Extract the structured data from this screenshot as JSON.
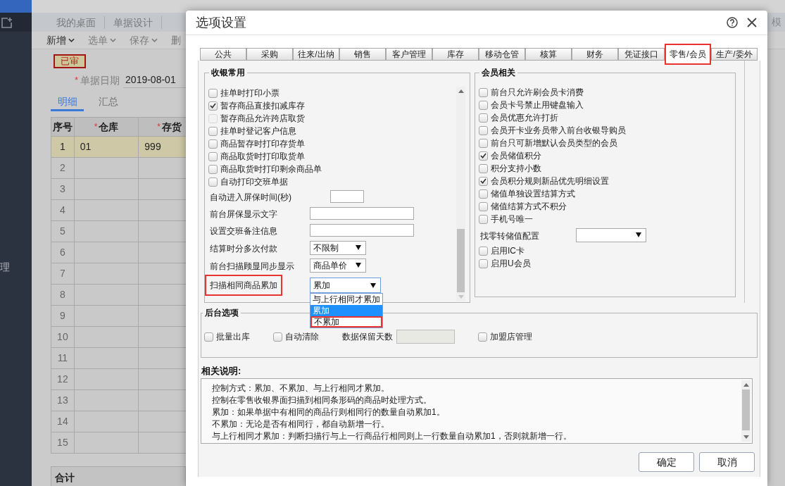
{
  "sidebar": {
    "menu_items": [
      {
        "label": "理"
      }
    ]
  },
  "nav_tabs": [
    {
      "label": "我的桌面"
    },
    {
      "label": "单据设计"
    }
  ],
  "nav_right": "模",
  "toolbar": [
    {
      "label": "新增",
      "caret": true,
      "disabled": false
    },
    {
      "label": "选单",
      "caret": true,
      "disabled": true
    },
    {
      "label": "保存",
      "caret": true,
      "disabled": true
    },
    {
      "label": "删",
      "caret": false,
      "disabled": true
    }
  ],
  "document": {
    "status_badge": "已审",
    "date_field": {
      "required_mark": "*",
      "label": "单据日期",
      "value": "2019-08-01"
    },
    "tabs": [
      {
        "label": "明细",
        "selected": true
      },
      {
        "label": "汇总",
        "selected": false
      }
    ],
    "table": {
      "columns": [
        {
          "label": "序号"
        },
        {
          "required_mark": "*",
          "label": "仓库"
        },
        {
          "required_mark": "*",
          "label": "存货"
        }
      ],
      "rows": [
        {
          "number": "1",
          "cells": [
            "01",
            "999"
          ],
          "selected": true
        },
        {
          "number": "2",
          "selected": false
        },
        {
          "number": "3",
          "selected": false
        },
        {
          "number": "4",
          "selected": false
        },
        {
          "number": "5",
          "selected": false
        },
        {
          "number": "6",
          "selected": false
        },
        {
          "number": "7",
          "selected": false
        },
        {
          "number": "8",
          "selected": false
        },
        {
          "number": "9",
          "selected": false
        },
        {
          "number": "10",
          "selected": false
        },
        {
          "number": "11",
          "selected": false
        },
        {
          "number": "12",
          "selected": false
        },
        {
          "number": "13",
          "selected": false
        },
        {
          "number": "14",
          "selected": false
        },
        {
          "number": "15",
          "selected": false
        }
      ],
      "footer_label": "合计"
    }
  },
  "dialog": {
    "title": "选项设置",
    "tabs": [
      {
        "label": "公共",
        "selected": false,
        "highlighted": false
      },
      {
        "label": "采购",
        "selected": false,
        "highlighted": false
      },
      {
        "label": "往来/出纳",
        "selected": false,
        "highlighted": false
      },
      {
        "label": "销售",
        "selected": false,
        "highlighted": false
      },
      {
        "label": "客户管理",
        "selected": false,
        "highlighted": false
      },
      {
        "label": "库存",
        "selected": false,
        "highlighted": false
      },
      {
        "label": "移动仓管",
        "selected": false,
        "highlighted": false
      },
      {
        "label": "核算",
        "selected": false,
        "highlighted": false
      },
      {
        "label": "财务",
        "selected": false,
        "highlighted": false
      },
      {
        "label": "凭证接口",
        "selected": false,
        "highlighted": false
      },
      {
        "label": "零售/会员",
        "selected": true,
        "highlighted": true
      },
      {
        "label": "生产/委外",
        "selected": false,
        "highlighted": false
      }
    ],
    "cashier_group": {
      "title": "收银常用",
      "options": [
        {
          "kind": "checkbox",
          "label": "挂单时打印小票",
          "checked": false,
          "disabled": false
        },
        {
          "kind": "checkbox",
          "label": "暂存商品直接扣减库存",
          "checked": true,
          "disabled": false
        },
        {
          "kind": "checkbox",
          "label": "暂存商品允许跨店取货",
          "checked": false,
          "disabled": true
        },
        {
          "kind": "checkbox",
          "label": "挂单时登记客户信息",
          "checked": false,
          "disabled": false
        },
        {
          "kind": "checkbox",
          "label": "商品暂存时打印存货单",
          "checked": false,
          "disabled": false
        },
        {
          "kind": "checkbox",
          "label": "商品取货时打印取货单",
          "checked": false,
          "disabled": false
        },
        {
          "kind": "checkbox",
          "label": "商品取货时打印剩余商品单",
          "checked": false,
          "disabled": false
        },
        {
          "kind": "checkbox",
          "label": "自动打印交班单据",
          "checked": false,
          "disabled": false
        },
        {
          "kind": "number",
          "label": "自动进入屏保时间(秒)",
          "disabled": false
        },
        {
          "kind": "text",
          "label": "前台屏保显示文字",
          "disabled": false
        },
        {
          "kind": "text",
          "label": "设置交班备注信息",
          "disabled": false
        },
        {
          "kind": "select",
          "label": "结算时分多次付款",
          "value": "不限制",
          "expanded": false,
          "highlighted": false
        },
        {
          "kind": "select",
          "label": "前台扫描顾显同步显示",
          "value": "商品单价",
          "expanded": false,
          "highlighted": false
        },
        {
          "kind": "select",
          "label": "扫描相同商品累加",
          "value": "累加",
          "expanded": true,
          "highlighted": true,
          "options": [
            {
              "label": "与上行相同才累加",
              "selected": false,
              "highlighted": false
            },
            {
              "label": "累加",
              "selected": true,
              "highlighted": false
            },
            {
              "label": "不累加",
              "selected": false,
              "highlighted": true
            }
          ]
        }
      ]
    },
    "member_group": {
      "title": "会员相关",
      "options": [
        {
          "kind": "checkbox",
          "label": "前台只允许刷会员卡消费",
          "checked": false,
          "disabled": false
        },
        {
          "kind": "checkbox",
          "label": "会员卡号禁止用键盘输入",
          "checked": false,
          "disabled": false
        },
        {
          "kind": "checkbox",
          "label": "会员优惠允许打折",
          "checked": false,
          "disabled": false
        },
        {
          "kind": "checkbox",
          "label": "会员开卡业务员带入前台收银导购员",
          "checked": false,
          "disabled": false
        },
        {
          "kind": "checkbox",
          "label": "前台只可新增默认会员类型的会员",
          "checked": false,
          "disabled": false
        },
        {
          "kind": "checkbox",
          "label": "会员储值积分",
          "checked": true,
          "disabled": false
        },
        {
          "kind": "checkbox",
          "label": "积分支持小数",
          "checked": false,
          "disabled": false
        },
        {
          "kind": "checkbox",
          "label": "会员积分规则新品优先明细设置",
          "checked": true,
          "disabled": false
        },
        {
          "kind": "checkbox",
          "label": "储值单独设置结算方式",
          "checked": false,
          "disabled": false
        },
        {
          "kind": "checkbox",
          "label": "储值结算方式不积分",
          "checked": false,
          "disabled": false
        },
        {
          "kind": "checkbox",
          "label": "手机号唯一",
          "checked": false,
          "disabled": false
        },
        {
          "kind": "select",
          "label": "找零转储值配置",
          "expanded": false,
          "highlighted": false
        },
        {
          "kind": "checkbox",
          "label": "启用IC卡",
          "checked": false,
          "disabled": false
        },
        {
          "kind": "checkbox",
          "label": "启用U会员",
          "checked": false,
          "disabled": false
        }
      ]
    },
    "backend_group": {
      "title": "后台选项",
      "options": [
        {
          "kind": "checkbox",
          "label": "批量出库",
          "checked": false,
          "disabled": false
        },
        {
          "kind": "checkbox",
          "label": "自动清除",
          "checked": false,
          "disabled": false
        },
        {
          "kind": "number",
          "label": "数据保留天数",
          "disabled": true
        },
        {
          "kind": "checkbox",
          "label": "加盟店管理",
          "checked": false,
          "disabled": false
        }
      ]
    },
    "description": {
      "title": "相关说明:",
      "lines": [
        "控制方式：累加、不累加、与上行相同才累加。",
        "控制在零售收银界面扫描到相同条形码的商品时处理方式。",
        "累加：如果单据中有相同的商品行则相同行的数量自动累加1。",
        "不累加：无论是否有相同行，都自动新增一行。",
        "与上行相同才累加：判断扫描行与上一行商品行相同则上一行数量自动累加1，否则就新增一行。"
      ]
    },
    "buttons": [
      {
        "label": "确定"
      },
      {
        "label": "取消"
      }
    ]
  }
}
